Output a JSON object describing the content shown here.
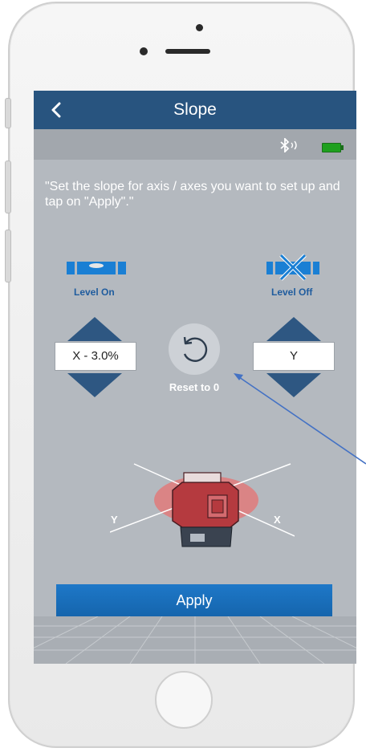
{
  "header": {
    "title": "Slope",
    "back_icon": "chevron-left-icon"
  },
  "status": {
    "bluetooth_icon": "bluetooth-icon",
    "battery_icon": "battery-icon"
  },
  "instruction": "\"Set the slope for axis / axes you want to set up and tap on \"Apply\".\"",
  "level_on": {
    "label": "Level On",
    "icon": "level-on-icon"
  },
  "level_off": {
    "label": "Level Off",
    "icon": "level-off-icon"
  },
  "x_axis": {
    "value": "X - 3.0%"
  },
  "y_axis": {
    "value": "Y"
  },
  "reset": {
    "label": "Reset to 0",
    "icon": "reset-icon"
  },
  "diagram": {
    "y_label": "Y",
    "x_label": "X"
  },
  "apply": {
    "label": "Apply"
  },
  "colors": {
    "navbar": "#28547f",
    "accent": "#2e5782",
    "apply": "#1e78c8",
    "screen_bg": "#b4b9bf",
    "annotation": "#4472c4"
  }
}
